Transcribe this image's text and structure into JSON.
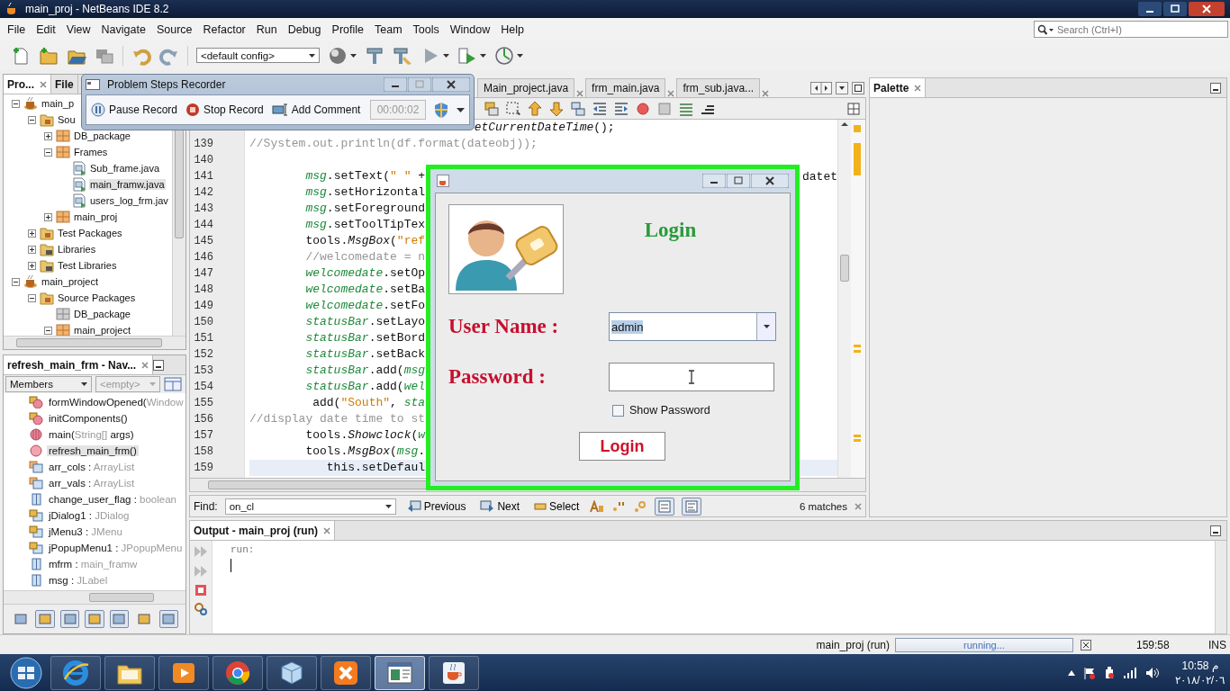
{
  "window": {
    "title": "main_proj - NetBeans IDE 8.2"
  },
  "menu": [
    "File",
    "Edit",
    "View",
    "Navigate",
    "Source",
    "Refactor",
    "Run",
    "Debug",
    "Profile",
    "Team",
    "Tools",
    "Window",
    "Help"
  ],
  "search": {
    "placeholder": "Search (Ctrl+I)"
  },
  "toolbar": {
    "config": "<default config>"
  },
  "projects": {
    "tabs": [
      {
        "label": "Pro...",
        "selected": true
      },
      {
        "label": "File",
        "selected": false
      }
    ],
    "tree": [
      {
        "label": "main_p",
        "kind": "project",
        "expanded": true,
        "selected": false,
        "children": [
          {
            "label": "Sou",
            "kind": "packages",
            "expanded": true,
            "selected": false,
            "children": [
              {
                "label": "DB_package",
                "kind": "package",
                "expanded": false,
                "selected": false
              },
              {
                "label": "Frames",
                "kind": "package",
                "expanded": true,
                "selected": false,
                "children": [
                  {
                    "label": "Sub_frame.java",
                    "kind": "form",
                    "selected": false
                  },
                  {
                    "label": "main_framw.java",
                    "kind": "form",
                    "selected": true
                  },
                  {
                    "label": "users_log_frm.jav",
                    "kind": "form",
                    "selected": false
                  }
                ]
              },
              {
                "label": "main_proj",
                "kind": "package",
                "expanded": false,
                "selected": false
              }
            ]
          },
          {
            "label": "Test Packages",
            "kind": "packages",
            "expanded": false,
            "selected": false
          },
          {
            "label": "Libraries",
            "kind": "libraries",
            "expanded": false,
            "selected": false
          },
          {
            "label": "Test Libraries",
            "kind": "libraries",
            "expanded": false,
            "selected": false
          }
        ]
      },
      {
        "label": "main_project",
        "kind": "project",
        "expanded": true,
        "selected": false,
        "children": [
          {
            "label": "Source Packages",
            "kind": "packages",
            "expanded": true,
            "selected": false,
            "children": [
              {
                "label": "DB_package",
                "kind": "empty-package",
                "selected": false
              },
              {
                "label": "main_project",
                "kind": "package",
                "expanded": true,
                "selected": false
              }
            ]
          }
        ]
      }
    ]
  },
  "navigator": {
    "title": "refresh_main_frm - Nav...",
    "view": "Members",
    "filter": "<empty>",
    "members": [
      {
        "name": "formWindowOpened(",
        "type": "Window",
        "kind": "private-method",
        "selected": false
      },
      {
        "name": "initComponents()",
        "kind": "private-method",
        "selected": false
      },
      {
        "name": "main(",
        "type": "String[]",
        "end": " args)",
        "kind": "static-method",
        "selected": false
      },
      {
        "name": "refresh_main_frm()",
        "kind": "method",
        "selected": true
      },
      {
        "name": "arr_cols : ",
        "type": "ArrayList",
        "kind": "package-field",
        "selected": false
      },
      {
        "name": "arr_vals : ",
        "type": "ArrayList",
        "kind": "package-field",
        "selected": false
      },
      {
        "name": "change_user_flag : ",
        "type": "boolean",
        "kind": "field",
        "selected": false
      },
      {
        "name": "jDialog1 : ",
        "type": "JDialog",
        "kind": "private-field",
        "selected": false
      },
      {
        "name": "jMenu3 : ",
        "type": "JMenu",
        "kind": "private-field",
        "selected": false
      },
      {
        "name": "jPopupMenu1 : ",
        "type": "JPopupMenu",
        "kind": "private-field",
        "selected": false
      },
      {
        "name": "mfrm : ",
        "type": "main_framw",
        "kind": "field",
        "selected": false
      },
      {
        "name": "msg : ",
        "type": "JLabel",
        "kind": "field",
        "selected": false
      }
    ],
    "buttons": [
      {
        "pressed": false
      },
      {
        "pressed": true
      },
      {
        "pressed": true
      },
      {
        "pressed": true
      },
      {
        "pressed": true
      },
      {
        "pressed": false
      },
      {
        "pressed": true
      }
    ]
  },
  "editor": {
    "tabs": [
      {
        "label": "Main_project.java",
        "selected": false
      },
      {
        "label": "frm_main.java",
        "selected": false
      },
      {
        "label": "frm_sub.java...",
        "selected": false
      }
    ],
    "lines": [
      {
        "current": false,
        "segments": [
          {
            "kind": "static",
            "text": "                                etCurrentDateTime"
          },
          {
            "kind": "plain",
            "text": "();"
          }
        ]
      },
      {
        "number": "139",
        "current": false,
        "segments": [
          {
            "kind": "comment",
            "text": "//System.out.println(df.format(dateobj));"
          }
        ]
      },
      {
        "number": "140",
        "current": false
      },
      {
        "number": "141",
        "current": false,
        "segments": [
          {
            "kind": "field",
            "text": "        msg"
          },
          {
            "kind": "plain",
            "text": ".setText("
          },
          {
            "kind": "string",
            "text": "\" \""
          },
          {
            "kind": "plain",
            "text": " +"
          }
        ],
        "tail": "datet"
      },
      {
        "number": "142",
        "current": false,
        "segments": [
          {
            "kind": "field",
            "text": "        msg"
          },
          {
            "kind": "plain",
            "text": ".setHorizontal"
          }
        ]
      },
      {
        "number": "143",
        "current": false,
        "segments": [
          {
            "kind": "field",
            "text": "        msg"
          },
          {
            "kind": "plain",
            "text": ".setForeground"
          }
        ]
      },
      {
        "number": "144",
        "current": false,
        "segments": [
          {
            "kind": "field",
            "text": "        msg"
          },
          {
            "kind": "plain",
            "text": ".setToolTipTex"
          }
        ]
      },
      {
        "number": "145",
        "current": false,
        "segments": [
          {
            "kind": "plain",
            "text": "        tools."
          },
          {
            "kind": "static",
            "text": "MsgBox"
          },
          {
            "kind": "plain",
            "text": "("
          },
          {
            "kind": "string",
            "text": "\"ref"
          }
        ]
      },
      {
        "number": "146",
        "current": false,
        "segments": [
          {
            "kind": "comment",
            "text": "        //welcomedate = n"
          }
        ]
      },
      {
        "number": "147",
        "current": false,
        "segments": [
          {
            "kind": "field",
            "text": "        welcomedate"
          },
          {
            "kind": "plain",
            "text": ".setOp"
          }
        ]
      },
      {
        "number": "148",
        "current": false,
        "segments": [
          {
            "kind": "field",
            "text": "        welcomedate"
          },
          {
            "kind": "plain",
            "text": ".setBa"
          }
        ]
      },
      {
        "number": "149",
        "current": false,
        "segments": [
          {
            "kind": "field",
            "text": "        welcomedate"
          },
          {
            "kind": "plain",
            "text": ".setFo"
          }
        ]
      },
      {
        "number": "150",
        "current": false,
        "segments": [
          {
            "kind": "field",
            "text": "        statusBar"
          },
          {
            "kind": "plain",
            "text": ".setLayo"
          }
        ]
      },
      {
        "number": "151",
        "current": false,
        "segments": [
          {
            "kind": "field",
            "text": "        statusBar"
          },
          {
            "kind": "plain",
            "text": ".setBord"
          }
        ]
      },
      {
        "number": "152",
        "current": false,
        "segments": [
          {
            "kind": "field",
            "text": "        statusBar"
          },
          {
            "kind": "plain",
            "text": ".setBack"
          }
        ]
      },
      {
        "number": "153",
        "current": false,
        "segments": [
          {
            "kind": "field",
            "text": "        statusBar"
          },
          {
            "kind": "plain",
            "text": ".add("
          },
          {
            "kind": "field",
            "text": "msg"
          }
        ]
      },
      {
        "number": "154",
        "current": false,
        "segments": [
          {
            "kind": "field",
            "text": "        statusBar"
          },
          {
            "kind": "plain",
            "text": ".add("
          },
          {
            "kind": "field",
            "text": "wel"
          }
        ]
      },
      {
        "number": "155",
        "current": false,
        "segments": [
          {
            "kind": "plain",
            "text": "         add("
          },
          {
            "kind": "string",
            "text": "\"South\""
          },
          {
            "kind": "plain",
            "text": ", "
          },
          {
            "kind": "field",
            "text": "sta"
          }
        ]
      },
      {
        "number": "156",
        "current": false,
        "segments": [
          {
            "kind": "comment",
            "text": "//display date time to st"
          }
        ]
      },
      {
        "number": "157",
        "current": false,
        "segments": [
          {
            "kind": "plain",
            "text": "        tools."
          },
          {
            "kind": "static",
            "text": "Showclock"
          },
          {
            "kind": "plain",
            "text": "("
          },
          {
            "kind": "field",
            "text": "w"
          }
        ]
      },
      {
        "number": "158",
        "current": false,
        "segments": [
          {
            "kind": "plain",
            "text": "        tools."
          },
          {
            "kind": "static",
            "text": "MsgBox"
          },
          {
            "kind": "plain",
            "text": "("
          },
          {
            "kind": "field",
            "text": "msg"
          },
          {
            "kind": "plain",
            "text": "."
          }
        ]
      },
      {
        "number": "159",
        "current": true,
        "segments": [
          {
            "kind": "plain",
            "text": "           this.setDefaul"
          }
        ]
      }
    ]
  },
  "find": {
    "label": "Find:",
    "value": "on_cl",
    "buttons": [
      "Previous",
      "Next",
      "Select"
    ],
    "matches": "6 matches"
  },
  "palette": {
    "title": "Palette"
  },
  "output": {
    "title": "Output - main_proj (run)",
    "lines": [
      "run:"
    ]
  },
  "status": {
    "task": "main_proj (run)",
    "progress": "running...",
    "level": 1,
    "position": "159:58",
    "mode": "INS"
  },
  "taskbar": {
    "apps": [
      {
        "kind": "browser",
        "selected": false
      },
      {
        "kind": "folder",
        "selected": false
      },
      {
        "kind": "media",
        "selected": false
      },
      {
        "kind": "round",
        "selected": false
      },
      {
        "kind": "cube",
        "selected": false
      },
      {
        "kind": "xampp",
        "selected": false
      },
      {
        "kind": "window",
        "selected": true
      },
      {
        "kind": "cup",
        "selected": false
      }
    ],
    "time": "10:58 م",
    "date": "٢٠١٨/٠٢/٠٦"
  },
  "recorder": {
    "title": "Problem Steps Recorder",
    "buttons": [
      "Pause Record",
      "Stop Record",
      "Add Comment"
    ],
    "timer": "00:00:02"
  },
  "login": {
    "heading": "Login",
    "username_label": "User Name :",
    "username": "admin",
    "password_label": "Password :",
    "show_password": {
      "label": "Show Password",
      "checked": false
    },
    "button": "Login"
  }
}
